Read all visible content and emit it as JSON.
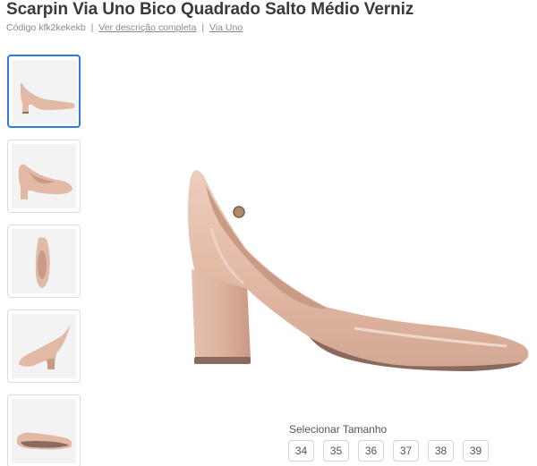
{
  "product": {
    "title": "Scarpin Via Uno Bico Quadrado Salto Médio Verniz",
    "code_label": "Código kfk2kekekb",
    "description_link": "Ver descrição completa",
    "brand_link": "Via Uno",
    "separator": "|"
  },
  "gallery": {
    "thumbnails": [
      {
        "view": "side-view",
        "active": true
      },
      {
        "view": "three-quarter-view",
        "active": false
      },
      {
        "view": "top-view",
        "active": false
      },
      {
        "view": "back-view",
        "active": false
      },
      {
        "view": "sole-view",
        "active": false
      }
    ],
    "main_image_view": "side-view"
  },
  "size_selector": {
    "label": "Selecionar Tamanho",
    "sizes": [
      "34",
      "35",
      "36",
      "37",
      "38",
      "39"
    ]
  },
  "colors": {
    "shoe": "#e2b9a5",
    "shoe_shadow": "#c99a86",
    "heel_base": "#8a6a5c",
    "accent_border": "#2b7de0"
  }
}
